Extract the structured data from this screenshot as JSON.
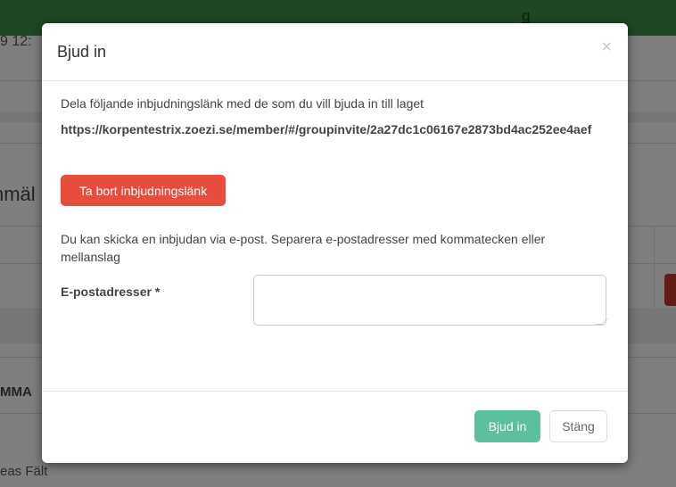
{
  "background": {
    "top_fragment": "g",
    "date_fragment": "9 12:",
    "heading_fragment": "nmäl",
    "section_fragment": "MMA",
    "name_fragment": "eas Fält"
  },
  "modal": {
    "title": "Bjud in",
    "close_symbol": "×",
    "description": "Dela följande inbjudningslänk med de som du vill bjuda in till laget",
    "invite_link": "https://korpentestrix.zoezi.se/member/#/groupinvite/2a27dc1c06167e2873bd4ac252ee4aef",
    "remove_link_label": "Ta bort inbjudningslänk",
    "email_description": "Du kan skicka en inbjudan via e-post. Separera e-postadresser med kommatecken eller mellanslag",
    "email_label": "E-postadresser *",
    "email_value": "",
    "invite_button": "Bjud in",
    "close_button": "Stäng"
  },
  "colors": {
    "topbar": "#3c8f46",
    "danger": "#e74c3c",
    "primary": "#5bbfa0"
  }
}
